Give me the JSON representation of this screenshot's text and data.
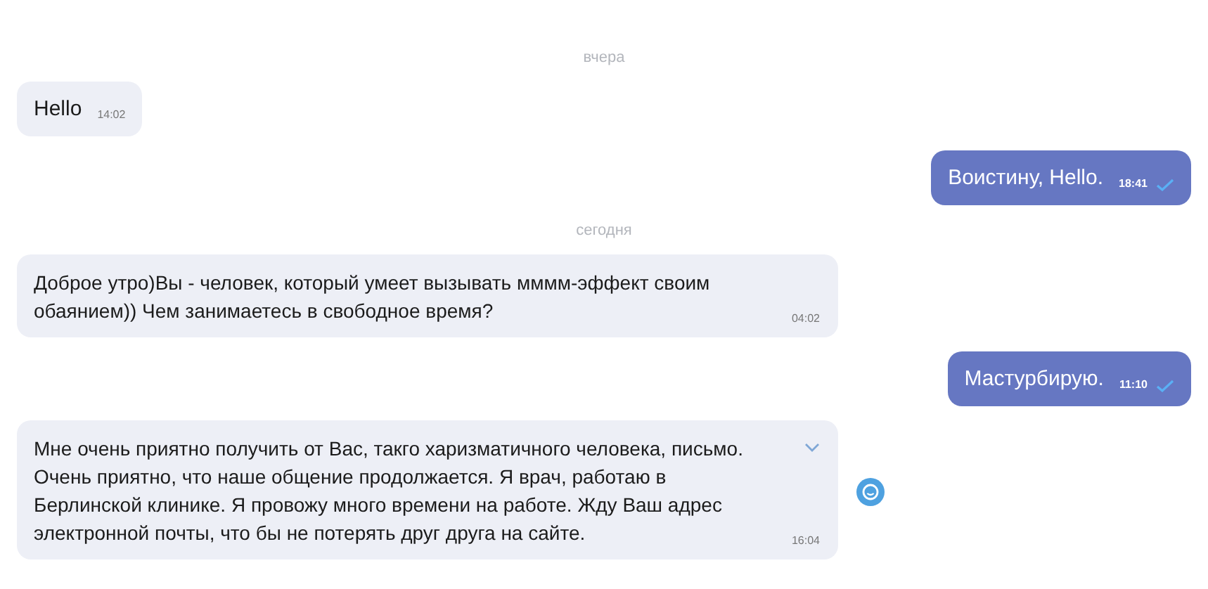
{
  "feed": [
    {
      "kind": "day",
      "label": "вчера"
    },
    {
      "kind": "message",
      "outgoing": false,
      "lines": [
        "Hello"
      ],
      "time": "14:02"
    },
    {
      "kind": "message",
      "outgoing": true,
      "lines": [
        "Воистину, Hello."
      ],
      "time": "18:41",
      "read": true
    },
    {
      "kind": "day",
      "label": "сегодня"
    },
    {
      "kind": "message",
      "outgoing": false,
      "lines": [
        "Доброе утро)Вы - человек, который умеет вызывать мммм-эффект своим",
        "обаянием)) Чем занимаетесь в свободное время?"
      ],
      "time": "04:02"
    },
    {
      "kind": "message",
      "outgoing": true,
      "lines": [
        "Мастурбирую."
      ],
      "time": "11:10",
      "read": true
    },
    {
      "kind": "message",
      "outgoing": false,
      "lines": [
        "Мне очень приятно получить от Вас, такго харизматичного человека, письмо.",
        "Очень приятно, что наше общение продолжается. Я врач, работаю в",
        "Берлинской клинике. Я провожу много времени на работе. Жду Ваш адрес",
        "электронной почты, что бы не потерять друг друга на сайте."
      ],
      "time": "16:04",
      "collapsed": true,
      "emoji_button": true
    }
  ]
}
